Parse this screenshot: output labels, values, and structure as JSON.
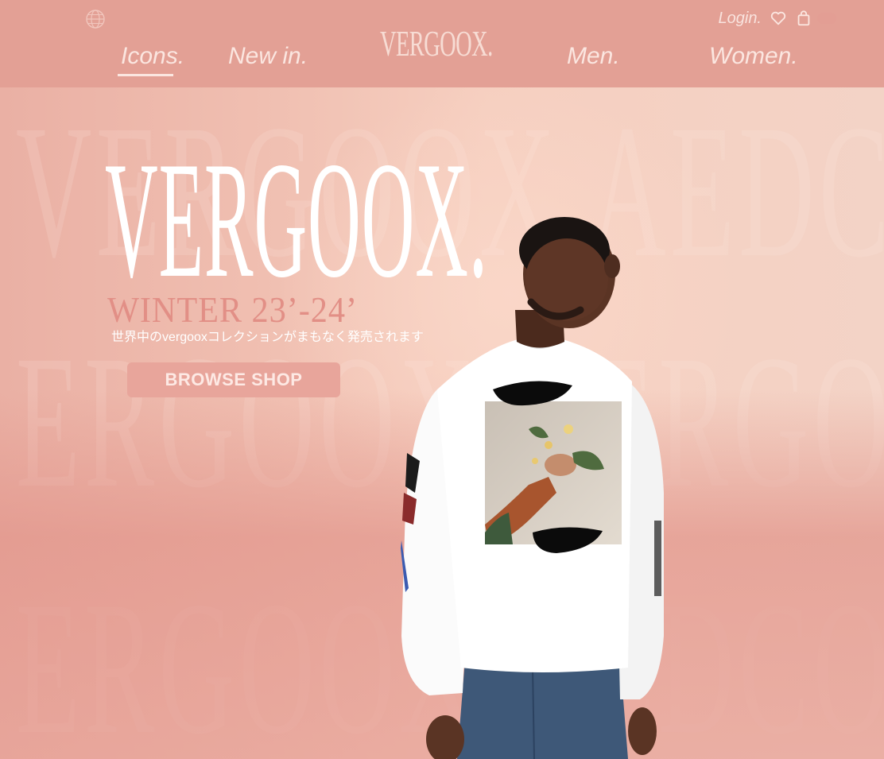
{
  "brand": {
    "logo_text": "VERGOOX."
  },
  "header": {
    "login_label": "Login.",
    "icons": [
      "globe-icon",
      "heart-icon",
      "bag-icon"
    ]
  },
  "nav": {
    "items": [
      {
        "label": "Icons.",
        "active": true
      },
      {
        "label": "New in.",
        "active": false
      },
      {
        "label": "Men.",
        "active": false
      },
      {
        "label": "Women.",
        "active": false
      }
    ]
  },
  "hero": {
    "title": "VERGOOX.",
    "subtitle": "WINTER 23’-24’",
    "tagline_jp": "世界中のvergooxコレクションがまもなく発売されます",
    "cta_label": "BROWSE SHOP",
    "background_words": [
      "VERGOOX.AEDCOOX.VERGO",
      "ERGOOX.VERGOOX.VERGO",
      "ERGOOX.AEDCOOX.VERGO"
    ]
  },
  "colors": {
    "header_bg": "#e3a095",
    "accent_text": "#e28f86",
    "button_bg": "#e8a59b",
    "white": "#ffffff"
  }
}
